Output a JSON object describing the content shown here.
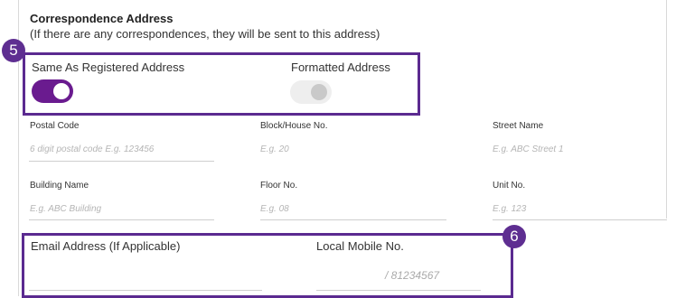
{
  "correspondence": {
    "title": "Correspondence Address",
    "subtitle": "(If there are any correspondences, they will be sent to this address)"
  },
  "badges": {
    "step5": "5",
    "step6": "6"
  },
  "options": {
    "same_as_registered": {
      "label": "Same As Registered Address",
      "state": "on"
    },
    "formatted_address": {
      "label": "Formatted Address",
      "state": "off"
    }
  },
  "fields": {
    "postal_code": {
      "label": "Postal Code",
      "placeholder": "6 digit postal code E.g. 123456"
    },
    "block_house": {
      "label": "Block/House No.",
      "placeholder": "E.g. 20"
    },
    "street_name": {
      "label": "Street Name",
      "placeholder": "E.g. ABC Street 1"
    },
    "building_name": {
      "label": "Building Name",
      "placeholder": "E.g. ABC Building"
    },
    "floor_no": {
      "label": "Floor No.",
      "placeholder": "E.g. 08"
    },
    "unit_no": {
      "label": "Unit No.",
      "placeholder": "E.g. 123"
    }
  },
  "contact": {
    "email": {
      "label": "Email Address (If Applicable)",
      "placeholder": ""
    },
    "mobile": {
      "label": "Local Mobile No.",
      "placeholder": "/ 81234567"
    }
  },
  "colors": {
    "accent": "#6a1b8f",
    "highlight_border": "#5b2a90",
    "badge": "#5e2e91"
  }
}
